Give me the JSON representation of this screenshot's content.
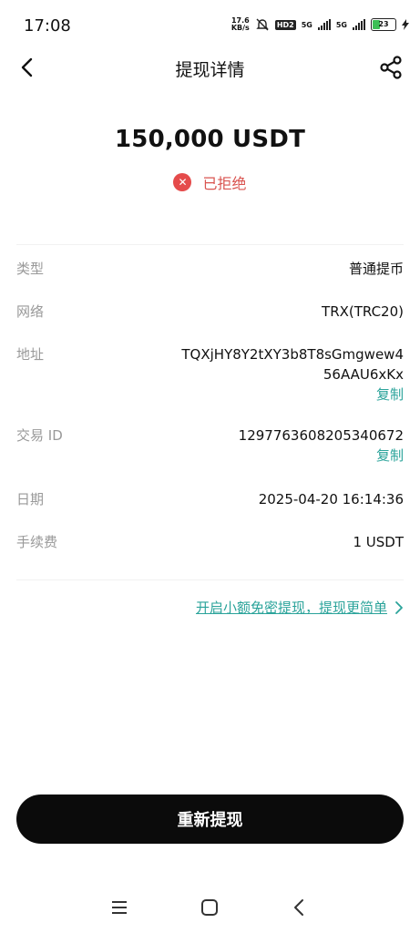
{
  "status_bar": {
    "time": "17:08",
    "net_speed_value": "17.6",
    "net_speed_unit": "KB/s",
    "hd_badge": "HD2",
    "signal1": "5G",
    "signal2": "5G",
    "battery": "23"
  },
  "header": {
    "title": "提现详情",
    "back_icon": "chevron-left-icon",
    "share_icon": "share-icon"
  },
  "summary": {
    "amount": "150,000 USDT",
    "status_text": "已拒绝",
    "status_icon": "close-circle-icon",
    "status_color": "#d9534f"
  },
  "details": {
    "type_label": "类型",
    "type_value": "普通提币",
    "network_label": "网络",
    "network_value": "TRX(TRC20)",
    "address_label": "地址",
    "address_line1": "TQXjHY8Y2tXY3b8T8sGmgwew4",
    "address_line2": "56AAU6xKx",
    "address_copy": "复制",
    "txid_label": "交易 ID",
    "txid_value": "1297763608205340672",
    "txid_copy": "复制",
    "date_label": "日期",
    "date_value": "2025-04-20 16:14:36",
    "fee_label": "手续费",
    "fee_value": "1 USDT"
  },
  "promo": {
    "text": "开启小额免密提现，提现更简单",
    "icon": "chevron-right-icon"
  },
  "action": {
    "button_label": "重新提现"
  },
  "system_nav": {
    "menu_icon": "menu-icon",
    "home_icon": "home-square-icon",
    "back_icon": "back-triangle-icon"
  },
  "colors": {
    "accent": "#2aa39a",
    "button_bg": "#0b0b0b",
    "error": "#e54b4b"
  }
}
